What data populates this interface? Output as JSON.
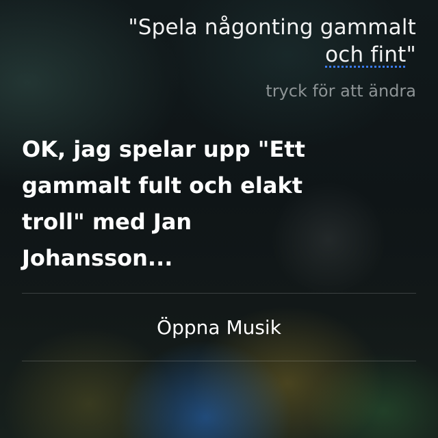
{
  "siri": {
    "query": {
      "line1": "\"Spela någonting gammalt",
      "line2_prefix": "",
      "line2_underlined": "och fint",
      "line2_suffix": "\""
    },
    "edit_hint": "tryck för att ändra",
    "response": {
      "lines": [
        "OK, jag spelar upp \"Ett",
        "gammalt fult och elakt",
        "troll\" med Jan",
        "Johansson..."
      ]
    },
    "action_button_label": "Öppna Musik"
  },
  "colors": {
    "underline_accent": "#3a7bf0",
    "hint_text": "#8e9496"
  }
}
